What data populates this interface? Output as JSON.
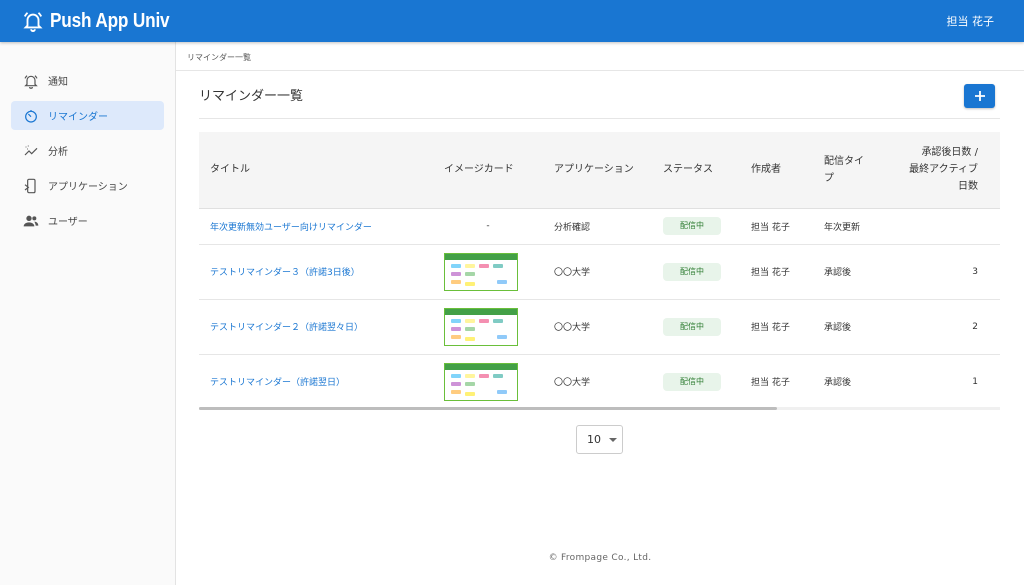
{
  "app": {
    "name": "Push App Univ",
    "user": "担当 花子"
  },
  "sidebar": {
    "items": [
      {
        "label": "通知",
        "icon": "bell-icon"
      },
      {
        "label": "リマインダー",
        "icon": "timer-icon"
      },
      {
        "label": "分析",
        "icon": "analytics-icon"
      },
      {
        "label": "アプリケーション",
        "icon": "app-icon"
      },
      {
        "label": "ユーザー",
        "icon": "users-icon"
      }
    ],
    "active_index": 1
  },
  "breadcrumb": "リマインダー一覧",
  "page": {
    "title": "リマインダー一覧",
    "add_label": "+"
  },
  "table": {
    "headers": {
      "title": "タイトル",
      "image": "イメージカード",
      "app": "アプリケーション",
      "status": "ステータス",
      "author": "作成者",
      "type_line1": "配信タイ",
      "type_line2": "プ",
      "days_line1": "承認後日数 /",
      "days_line2": "最終アクティブ",
      "days_line3": "日数"
    },
    "rows": [
      {
        "title": "年次更新無効ユーザー向けリマインダー",
        "image": "-",
        "app": "分析確認",
        "status": "配信中",
        "author": "担当 花子",
        "type": "年次更新",
        "days": ""
      },
      {
        "title": "テストリマインダー３（許諾3日後）",
        "image": "thumbnail",
        "app": "〇〇大学",
        "status": "配信中",
        "author": "担当 花子",
        "type": "承認後",
        "days": "3"
      },
      {
        "title": "テストリマインダー２（許諾翌々日）",
        "image": "thumbnail",
        "app": "〇〇大学",
        "status": "配信中",
        "author": "担当 花子",
        "type": "承認後",
        "days": "2"
      },
      {
        "title": "テストリマインダー（許諾翌日）",
        "image": "thumbnail",
        "app": "〇〇大学",
        "status": "配信中",
        "author": "担当 花子",
        "type": "承認後",
        "days": "1"
      }
    ]
  },
  "pagination": {
    "rows_per_page": "10"
  },
  "footer": "© Frompage Co., Ltd.",
  "colors": {
    "primary": "#1976d2",
    "status_bg": "#e8f4ea",
    "status_text": "#2e7d32"
  }
}
